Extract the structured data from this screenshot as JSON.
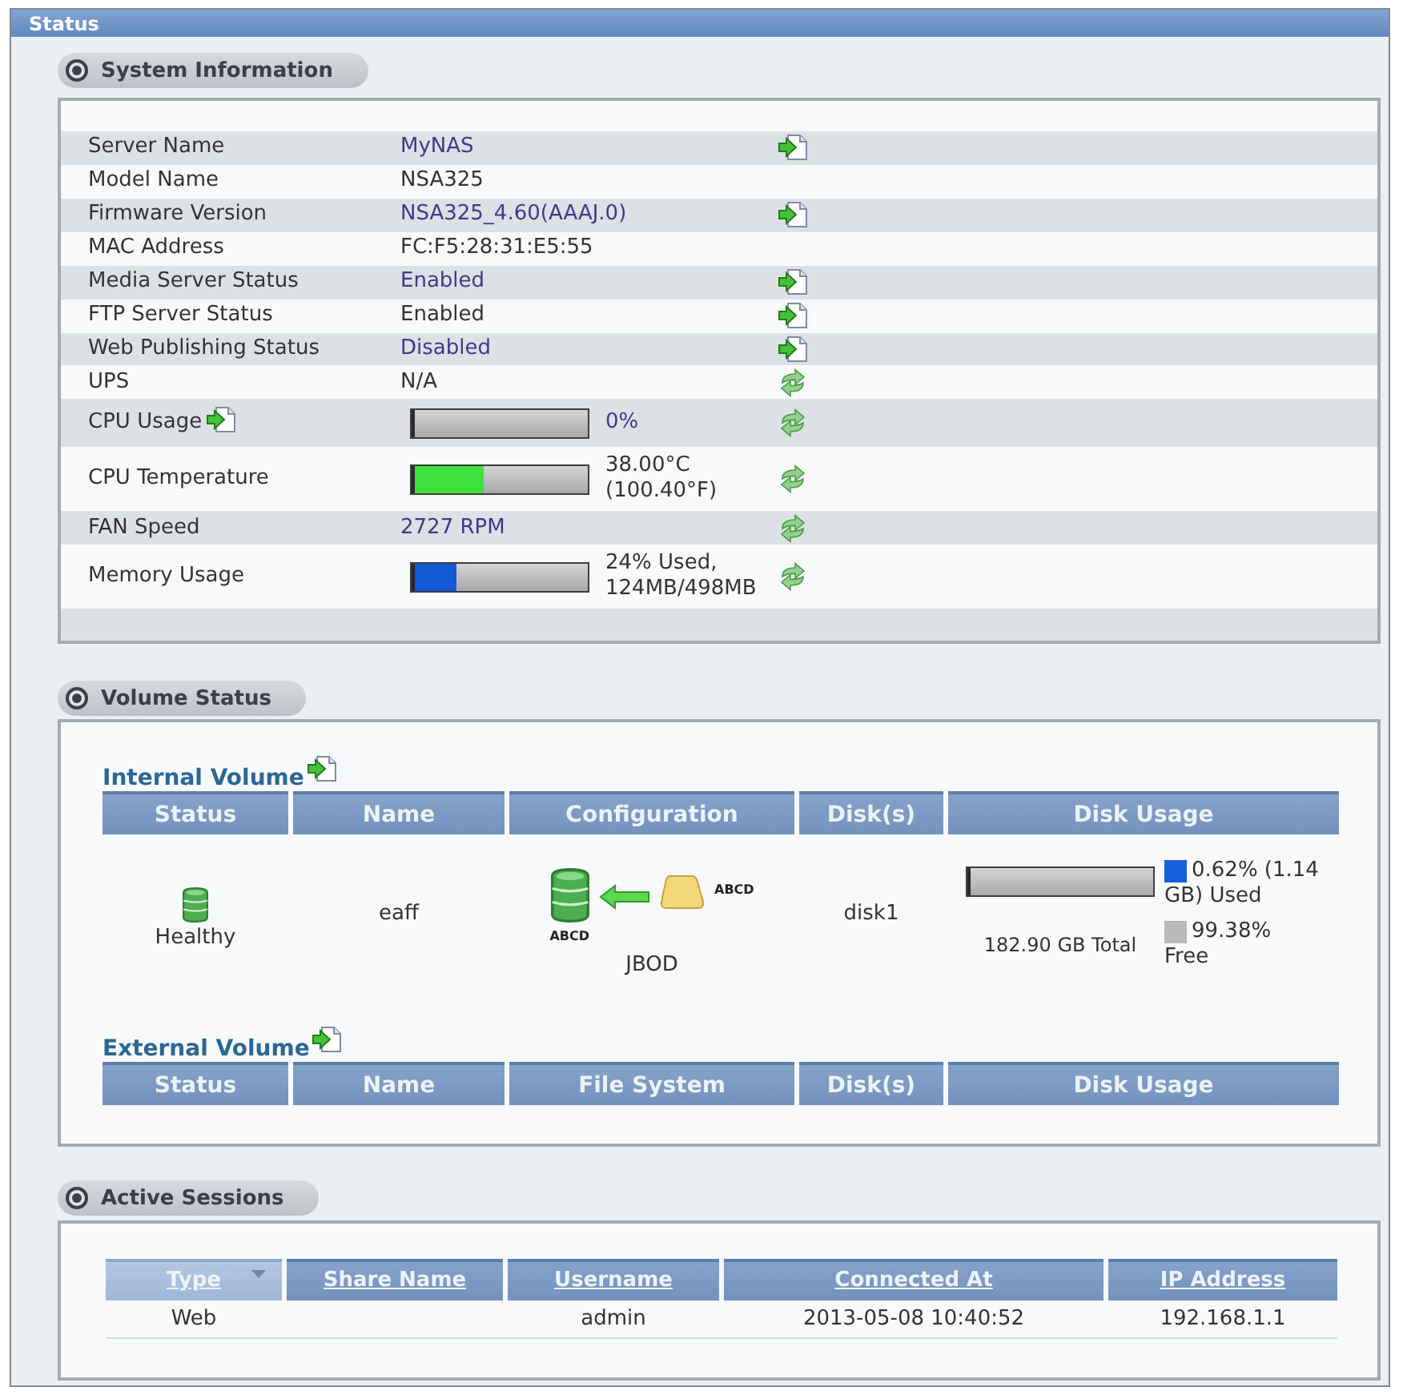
{
  "window": {
    "title": "Status"
  },
  "system_information": {
    "title": "System Information",
    "rows": [
      {
        "kind": "text",
        "label": "Server Name",
        "value": "MyNAS",
        "action": {
          "kind": "go"
        }
      },
      {
        "kind": "text",
        "label": "Model Name",
        "value": "NSA325"
      },
      {
        "kind": "text",
        "label": "Firmware Version",
        "value": "NSA325_4.60(AAAJ.0)",
        "action": {
          "kind": "go"
        }
      },
      {
        "kind": "text",
        "label": "MAC Address",
        "value": "FC:F5:28:31:E5:55"
      },
      {
        "kind": "text",
        "label": "Media Server Status",
        "value": "Enabled",
        "action": {
          "kind": "go"
        }
      },
      {
        "kind": "text",
        "label": "FTP Server Status",
        "value": "Enabled",
        "action": {
          "kind": "go"
        }
      },
      {
        "kind": "text",
        "label": "Web Publishing Status",
        "value": "Disabled",
        "action": {
          "kind": "go"
        }
      },
      {
        "kind": "text",
        "label": "UPS",
        "value": "N/A",
        "action": {
          "kind": "refresh"
        }
      },
      {
        "kind": "meter",
        "label": "CPU Usage",
        "label_action": {
          "kind": "go"
        },
        "level": 0,
        "reading": "0%",
        "action": {
          "kind": "refresh"
        }
      },
      {
        "kind": "meter",
        "label": "CPU Temperature",
        "level": 0.41,
        "color": "#3de23a",
        "reading": "38.00°C (100.40°F)",
        "action": {
          "kind": "refresh"
        }
      },
      {
        "kind": "text",
        "label": "FAN Speed",
        "value": "2727 RPM",
        "action": {
          "kind": "refresh"
        }
      },
      {
        "kind": "meter",
        "label": "Memory Usage",
        "level": 0.25,
        "color": "#1458d6",
        "reading": "24% Used, 124MB/498MB",
        "action": {
          "kind": "refresh"
        }
      }
    ]
  },
  "volume_status": {
    "title": "Volume Status",
    "internal_volume": {
      "title": "Internal Volume",
      "action": {
        "kind": "go"
      },
      "columns": [
        "Status",
        "Name",
        "Configuration",
        "Disk(s)",
        "Disk Usage"
      ],
      "rows": [
        {
          "status": "Healthy",
          "name": "eaff",
          "configuration": {
            "type": "JBOD",
            "volume_label": "ABCD",
            "disk_label": "ABCD"
          },
          "disks": "disk1",
          "usage": {
            "level": 0.0062,
            "total": "182.90 GB Total",
            "legend": [
              {
                "label": "0.62% (1.14 GB) Used",
                "color": "#1560e0"
              },
              {
                "label": "99.38% Free",
                "color": "#b9b9b9"
              }
            ]
          }
        }
      ]
    },
    "external_volume": {
      "title": "External Volume",
      "action": {
        "kind": "go"
      },
      "columns": [
        "Status",
        "Name",
        "File System",
        "Disk(s)",
        "Disk Usage"
      ]
    }
  },
  "active_sessions": {
    "title": "Active Sessions",
    "columns": [
      {
        "label": "Type",
        "sorted": true
      },
      {
        "label": "Share Name",
        "sorted": false
      },
      {
        "label": "Username",
        "sorted": false
      },
      {
        "label": "Connected At",
        "sorted": false
      },
      {
        "label": "IP Address",
        "sorted": false
      }
    ],
    "rows": [
      {
        "cells": [
          "Web",
          null,
          "admin",
          "2013-05-08 10:40:52",
          "192.168.1.1"
        ]
      }
    ]
  }
}
